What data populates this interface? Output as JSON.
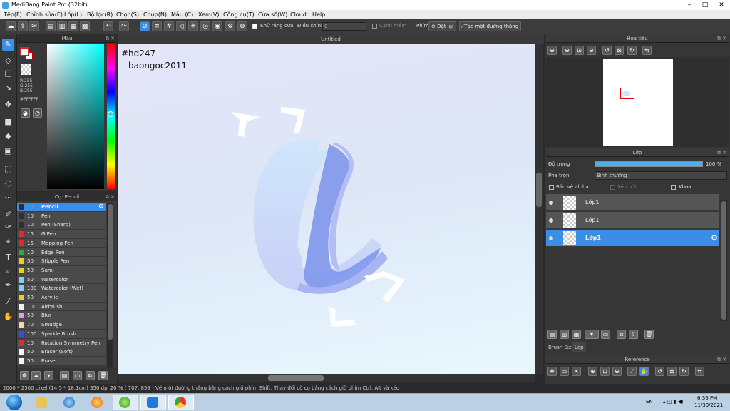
{
  "window": {
    "title": "MediBang Paint Pro (32bit)",
    "minimize": "–",
    "maximize": "□",
    "close": "✕"
  },
  "menu": [
    "Tệp(F)",
    "Chỉnh sửa(E)",
    "Lớp(L)",
    "Bộ lọc(R)",
    "Chọn(S)",
    "Chụp(N)",
    "Màu (C)",
    "Xem(V)",
    "Công cụ(T)",
    "Cửa sổ(W)",
    "Cloud",
    "Help"
  ],
  "toolbar": {
    "antialias_label": "Khử răng cưa",
    "correction_label": "Điều chỉnh",
    "correction_value": "0",
    "smooth_label": "Cạnh mềm",
    "key_label": "Phím",
    "reset_label": "Đặt lại",
    "straight_line_label": "Tạo một đường thẳng"
  },
  "color_panel": {
    "title": "Màu",
    "r": "R:255",
    "g": "G:255",
    "b": "B:255",
    "hex": "#FFFFFF"
  },
  "brush_panel": {
    "title": "Cọ: Pencil",
    "brushes": [
      {
        "size": "10",
        "name": "Pencil",
        "color": "#2f2f2f"
      },
      {
        "size": "10",
        "name": "Pen",
        "color": "#2f2f2f"
      },
      {
        "size": "10",
        "name": "Pen (Sharp)",
        "color": "#2f2f2f"
      },
      {
        "size": "15",
        "name": "G Pen",
        "color": "#e02a2a"
      },
      {
        "size": "15",
        "name": "Mapping Pen",
        "color": "#e02a2a"
      },
      {
        "size": "10",
        "name": "Edge Pen",
        "color": "#2fae2f"
      },
      {
        "size": "50",
        "name": "Stipple Pen",
        "color": "#e8d020"
      },
      {
        "size": "50",
        "name": "Sumi",
        "color": "#e8d020"
      },
      {
        "size": "50",
        "name": "Watercolor",
        "color": "#7fd0f0"
      },
      {
        "size": "100",
        "name": "Watercolor (Wet)",
        "color": "#7fd0f0"
      },
      {
        "size": "50",
        "name": "Acrylic",
        "color": "#e8d020"
      },
      {
        "size": "100",
        "name": "Airbrush",
        "color": "#f0f0f0"
      },
      {
        "size": "50",
        "name": "Blur",
        "color": "#e0a0e8"
      },
      {
        "size": "70",
        "name": "Smudge",
        "color": "#f0d8c0"
      },
      {
        "size": "100",
        "name": "Sparkle Brush",
        "color": "#3050e0"
      },
      {
        "size": "10",
        "name": "Rotation Symmetry Pen",
        "color": "#e02a2a"
      },
      {
        "size": "50",
        "name": "Eraser (Soft)",
        "color": "#f4f4f4"
      },
      {
        "size": "50",
        "name": "Eraser",
        "color": "#f4f4f4"
      }
    ]
  },
  "canvas": {
    "tab": "Untitled",
    "text_line1": "#hd247",
    "text_line2": "baongoc2011"
  },
  "navigator": {
    "title": "Hoa tiêu"
  },
  "layer_panel": {
    "title": "Lớp",
    "opacity_label": "Độ trong",
    "opacity_value": "100 %",
    "opacity": 1.0,
    "blend_label": "Pha trộn",
    "blend_value": "Bình thường",
    "alpha_protect": "Bảo vệ alpha",
    "clipping": "Xén bớt",
    "lock": "Khóa",
    "layers": [
      {
        "name": "Lớp1",
        "selected": false
      },
      {
        "name": "Lớp1",
        "selected": false
      },
      {
        "name": "Lớp1",
        "selected": true
      }
    ]
  },
  "tabs": [
    "Brush Size",
    "Lớp"
  ],
  "reference": {
    "title": "Reference"
  },
  "status": "2000 * 2500 pixel   (14.5 * 18.1cm)   350 dpi   20 %   ( 707, 859 )   Vẽ một đường thẳng bằng cách giữ phím Shift, Thay đổi cỡ cọ bằng cách giữ phím Ctrl, Alt và kéo",
  "tray": {
    "lang": "EN",
    "time": "6:36 PM",
    "date": "11/30/2021"
  },
  "taskbar_apps": [
    "explorer",
    "internet-explorer",
    "media-player",
    "360-browser",
    "zalo",
    "chrome"
  ]
}
